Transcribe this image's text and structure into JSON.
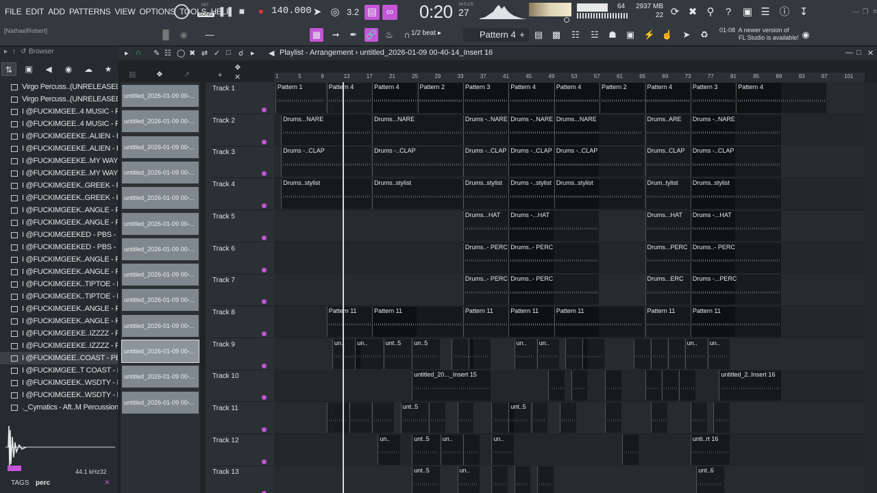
{
  "menu": [
    "FILE",
    "EDIT",
    "ADD",
    "PATTERNS",
    "VIEW",
    "OPTIONS",
    "TOOLS",
    "HELP"
  ],
  "transport": {
    "mode_top": "PAT",
    "mode": "SONG",
    "tempo": "140.000",
    "time_main": "0:20",
    "time_ms": "27",
    "time_label": "M:S:CS",
    "beat_counter": "3.2",
    "polyphony": "64",
    "memory": "2937 MB",
    "cpu": "22"
  },
  "user_label": "[NathaelRobert]",
  "snap": "1/2 beat",
  "current_pattern": "Pattern 4",
  "update_hint": {
    "id": "01-08",
    "line1": "A newer version of",
    "line2": "FL Studio is available!"
  },
  "browser": {
    "title": "Browser",
    "items": [
      {
        "label": "Virgo Percuss..(UNRELEASED)",
        "kind": "folder"
      },
      {
        "label": "Virgo Percuss..(UNRELEASED)",
        "kind": "folder"
      },
      {
        "label": "I @FUCKIMGEE..4 MUSIC - PERC",
        "kind": "file"
      },
      {
        "label": "I @FUCKIMGEE..4 MUSIC - PERC",
        "kind": "file"
      },
      {
        "label": "I @FUCKIMGEEKE..ALIEN - PERC",
        "kind": "file"
      },
      {
        "label": "I @FUCKIMGEEKE..ALIEN - PERC",
        "kind": "file"
      },
      {
        "label": "I @FUCKIMGEEKE..MY WAYZ - PERC",
        "kind": "file"
      },
      {
        "label": "I @FUCKIMGEEKE..MY WAYZ - PERC",
        "kind": "file"
      },
      {
        "label": "I @FUCKIMGEEK..GREEK - PERC",
        "kind": "file"
      },
      {
        "label": "I @FUCKIMGEEK..GREEK - PERC",
        "kind": "file"
      },
      {
        "label": "I @FUCKIMGEEK..ANGLE - PERC",
        "kind": "file"
      },
      {
        "label": "I @FUCKIMGEEK..ANGLE - PERC",
        "kind": "file"
      },
      {
        "label": "I @FUCKIMGEEKED - PBS - PERC",
        "kind": "file"
      },
      {
        "label": "I @FUCKIMGEEKED - PBS - PERC",
        "kind": "file"
      },
      {
        "label": "I @FUCKIMGEEK..ANGLE - PERC",
        "kind": "file"
      },
      {
        "label": "I @FUCKIMGEEK..ANGLE - PERC",
        "kind": "file"
      },
      {
        "label": "I @FUCKIMGEEK..TIPTOE - PERC",
        "kind": "file"
      },
      {
        "label": "I @FUCKIMGEEK..TIPTOE - PERC",
        "kind": "file"
      },
      {
        "label": "I @FUCKIMGEEK..ANGLE - PERC",
        "kind": "file"
      },
      {
        "label": "I @FUCKIMGEEK..ANGLE - PERC",
        "kind": "file"
      },
      {
        "label": "I @FUCKIMGEEKE..IZZZZ - PERC",
        "kind": "file"
      },
      {
        "label": "I @FUCKIMGEEKE..IZZZZ - PERC",
        "kind": "file"
      },
      {
        "label": "I @FUCKIMGEE..COAST - PERC",
        "kind": "file"
      },
      {
        "label": "I @FUCKIMGEE..T COAST - PERC",
        "kind": "file"
      },
      {
        "label": "I @FUCKIMGEEK..WSDTY - PERC",
        "kind": "file"
      },
      {
        "label": "I @FUCKIMGEEK..WSDTY - PERC",
        "kind": "file"
      },
      {
        "label": "._Cymatics - Aft..M Percussion 1",
        "kind": "file"
      }
    ],
    "sample_rate": "44.1 kHz",
    "bit_depth": "32",
    "tags_label": "TAGS",
    "tags_value": "perc"
  },
  "playlist": {
    "title": "Playlist - Arrangement",
    "crumb": "untitled_2026-01-09 00-40-14_Insert 16",
    "picker_items": [
      "untitled_2026-01-09 00-...",
      "untitled_2026-01-09 00-...",
      "untitled_2026-01-09 00-...",
      "untitled_2026-01-09 00-...",
      "untitled_2026-01-09 00-...",
      "untitled_2026-01-09 00-...",
      "untitled_2026-01-09 00-...",
      "untitled_2026-01-09 00-...",
      "untitled_2026-01-09 00-...",
      "untitled_2026-01-09 00-...",
      "untitled_2026-01-09 00-...",
      "untitled_2026-01-09 00-...",
      "untitled_2026-01-09 00-..."
    ],
    "ruler": [
      "1",
      "5",
      "9",
      "13",
      "17",
      "21",
      "25",
      "29",
      "33",
      "37",
      "41",
      "45",
      "49",
      "53",
      "57",
      "61",
      "65",
      "69",
      "73",
      "77",
      "81",
      "85",
      "89",
      "93",
      "97",
      "101"
    ],
    "tracks": [
      {
        "name": "Track 1",
        "clips": [
          [
            "Pattern 1",
            0,
            9
          ],
          [
            "Pattern 4",
            9,
            16
          ],
          [
            "Pattern 4",
            17,
            16
          ],
          [
            "Pattern 2",
            25,
            16
          ],
          [
            "Pattern 3",
            33,
            16
          ],
          [
            "Pattern 4",
            41,
            16
          ],
          [
            "Pattern 4",
            49,
            16
          ],
          [
            "Pattern 2",
            57,
            16
          ],
          [
            "Pattern 4",
            65,
            16
          ],
          [
            "Pattern 3",
            73,
            16
          ],
          [
            "Pattern 4",
            81,
            16
          ]
        ]
      },
      {
        "name": "Track 2",
        "clips": [
          [
            "Drums...NARE",
            1,
            16
          ],
          [
            "Drums...NARE",
            17,
            16
          ],
          [
            "Drums -..NARE",
            33,
            16
          ],
          [
            "Drums -..NARE",
            41,
            16
          ],
          [
            "Drums...NARE",
            49,
            16
          ],
          [
            "Drums..ARE",
            65,
            16
          ],
          [
            "Drums -..NARE",
            73,
            16
          ]
        ]
      },
      {
        "name": "Track 3",
        "clips": [
          [
            "Drums -..CLAP",
            1,
            16
          ],
          [
            "Drums -..CLAP",
            17,
            16
          ],
          [
            "Drums -..CLAP",
            33,
            16
          ],
          [
            "Drums -..CLAP",
            41,
            16
          ],
          [
            "Drums -..CLAP",
            49,
            16
          ],
          [
            "Drums..CLAP",
            65,
            16
          ],
          [
            "Drums -..CLAP",
            73,
            16
          ]
        ]
      },
      {
        "name": "Track 4",
        "clips": [
          [
            "Drums..stylist",
            1,
            16
          ],
          [
            "Drums..stylist",
            17,
            16
          ],
          [
            "Drums..stylist",
            33,
            16
          ],
          [
            "Drums -..stylist",
            41,
            16
          ],
          [
            "Drums..stylist",
            49,
            16
          ],
          [
            "Drum..tylist",
            65,
            16
          ],
          [
            "Drums..stylist",
            73,
            16
          ]
        ]
      },
      {
        "name": "Track 5",
        "clips": [
          [
            "Drums...HAT",
            33,
            16
          ],
          [
            "Drums -...HAT",
            41,
            16
          ],
          [
            "Drums...HAT",
            65,
            16
          ],
          [
            "Drums -...HAT",
            73,
            16
          ]
        ]
      },
      {
        "name": "Track 6",
        "clips": [
          [
            "Drums..- PERC",
            33,
            16
          ],
          [
            "Drums..- PERC",
            41,
            16
          ],
          [
            "Drums...PERC",
            65,
            16
          ],
          [
            "Drums..- PERC",
            73,
            16
          ]
        ]
      },
      {
        "name": "Track 7",
        "clips": [
          [
            "Drums..- PERC",
            33,
            16
          ],
          [
            "Drums..- PERC",
            41,
            16
          ],
          [
            "Drums...ERC",
            65,
            16
          ],
          [
            "Drums -...PERC",
            73,
            16
          ]
        ]
      },
      {
        "name": "Track 8",
        "clips": [
          [
            "Pattern 11",
            9,
            16
          ],
          [
            "Pattern 11",
            17,
            16
          ],
          [
            "Pattern 11",
            33,
            16
          ],
          [
            "Pattern 11",
            41,
            16
          ],
          [
            "Pattern 11",
            49,
            16
          ],
          [
            "Pattern 11",
            65,
            16
          ],
          [
            "Pattern 11",
            73,
            16
          ]
        ]
      },
      {
        "name": "Track 9",
        "clips": [
          [
            "un..",
            10,
            5
          ],
          [
            "un..",
            14,
            5
          ],
          [
            "unt..5",
            19,
            5
          ],
          [
            "un..5",
            24,
            5
          ],
          [
            "",
            31,
            4
          ],
          [
            "",
            34,
            4
          ],
          [
            "un..",
            42,
            4
          ],
          [
            "un..",
            46,
            4
          ],
          [
            "",
            51,
            4
          ],
          [
            "",
            54,
            4
          ],
          [
            "",
            63,
            3
          ],
          [
            "",
            66,
            3
          ],
          [
            "",
            69,
            3
          ],
          [
            "un..",
            72,
            4
          ],
          [
            "un..",
            76,
            4
          ]
        ]
      },
      {
        "name": "Track 10",
        "clips": [
          [
            "untitled_20..._Insert 15",
            24,
            14
          ],
          [
            "",
            48,
            3
          ],
          [
            "",
            52,
            3
          ],
          [
            "",
            58,
            3
          ],
          [
            "",
            65,
            3
          ],
          [
            "",
            68,
            3
          ],
          [
            "",
            71,
            3
          ],
          [
            "untitled_2..Insert 16",
            78,
            11
          ]
        ]
      },
      {
        "name": "Track 11",
        "clips": [
          [
            "",
            9,
            4
          ],
          [
            "",
            13,
            4
          ],
          [
            "",
            17,
            4
          ],
          [
            "unt..5",
            22,
            5
          ],
          [
            "",
            27,
            3
          ],
          [
            "",
            32,
            3
          ],
          [
            "",
            38,
            4
          ],
          [
            "unt..5",
            41,
            4
          ],
          [
            "",
            45,
            3
          ],
          [
            "",
            50,
            3
          ],
          [
            "",
            58,
            3
          ],
          [
            "",
            66,
            3
          ],
          [
            "",
            73,
            3
          ],
          [
            "",
            77,
            3
          ]
        ]
      },
      {
        "name": "Track 12",
        "clips": [
          [
            "un..",
            18,
            4
          ],
          [
            "unt..5",
            24,
            5
          ],
          [
            "un..",
            29,
            4
          ],
          [
            "",
            33,
            3
          ],
          [
            "un..",
            38,
            4
          ],
          [
            "",
            61,
            3
          ],
          [
            "unti..rt 16",
            73,
            7
          ]
        ]
      },
      {
        "name": "Track 13",
        "clips": [
          [
            "unt..5",
            24,
            5
          ],
          [
            "un..",
            32,
            4
          ],
          [
            "",
            38,
            3
          ],
          [
            "",
            42,
            3
          ],
          [
            "",
            46,
            3
          ],
          [
            "unt..6",
            74,
            5
          ]
        ]
      }
    ]
  },
  "colors": {
    "accent": "#c455d6",
    "playhead": "#d9dde0"
  }
}
